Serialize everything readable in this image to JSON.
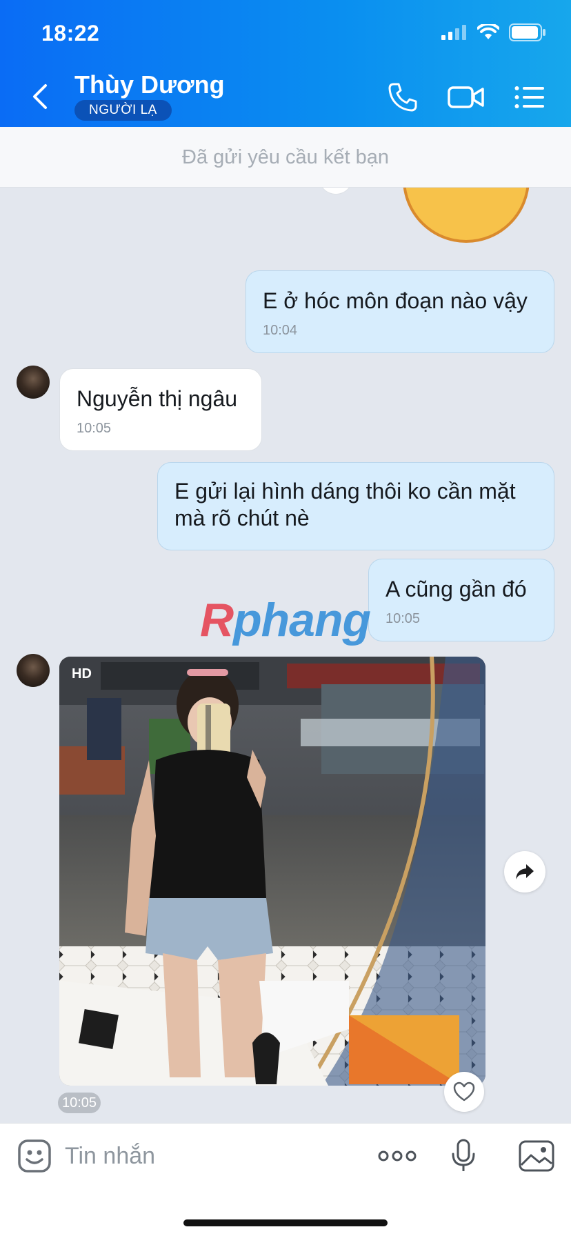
{
  "status_bar": {
    "time": "18:22"
  },
  "header": {
    "contact_name": "Thùy Dương",
    "badge": "NGƯỜI LẠ"
  },
  "friend_request_bar": {
    "text": "Đã gửi yêu cầu kết bạn"
  },
  "messages": [
    {
      "direction": "out",
      "text": "E ở hóc môn đoạn nào vậy",
      "time": "10:04"
    },
    {
      "direction": "in",
      "text": "Nguyễn thị ngâu",
      "time": "10:05"
    },
    {
      "direction": "out",
      "text": "E gửi lại hình dáng thôi ko cần mặt mà rõ chút nè",
      "time": ""
    },
    {
      "direction": "out",
      "text": "A cũng gần đó",
      "time": "10:05"
    },
    {
      "direction": "in",
      "type": "photo",
      "badge": "HD",
      "time": "10:05"
    }
  ],
  "watermark": {
    "part1": "R",
    "part2": "phang"
  },
  "input": {
    "placeholder": "Tin nhắn"
  },
  "icons": {
    "back": "chevron-left-icon",
    "call": "phone-icon",
    "video": "video-camera-icon",
    "menu": "list-menu-icon",
    "sticker": "emoji-icon",
    "more": "more-dots-icon",
    "mic": "microphone-icon",
    "image": "image-icon",
    "share": "share-icon",
    "like": "heart-icon"
  },
  "colors": {
    "header_start": "#0a6cf5",
    "header_end": "#17a7ec",
    "out_bubble": "#d7edfd",
    "in_bubble": "#ffffff",
    "chat_bg": "#e3e7ee"
  }
}
